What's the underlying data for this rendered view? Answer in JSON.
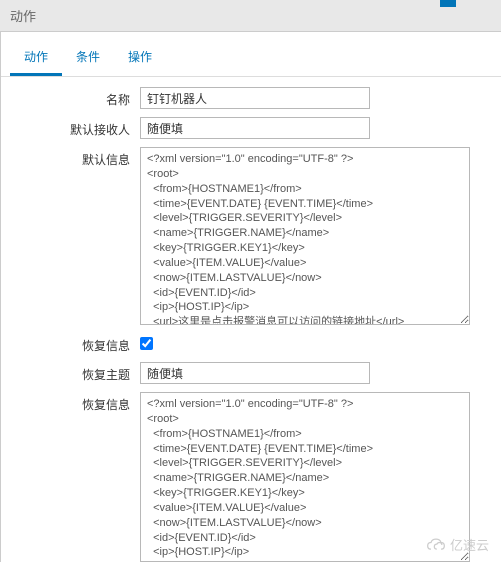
{
  "header": {
    "title": "动作"
  },
  "tabs": [
    {
      "label": "动作",
      "active": true
    },
    {
      "label": "条件",
      "active": false
    },
    {
      "label": "操作",
      "active": false
    }
  ],
  "form": {
    "name_label": "名称",
    "name_value": "钉钉机器人",
    "recipient_label": "默认接收人",
    "recipient_value": "随便填",
    "info_label": "默认信息",
    "info_value": "<?xml version=\"1.0\" encoding=\"UTF-8\" ?>\n<root>\n  <from>{HOSTNAME1}</from>\n  <time>{EVENT.DATE} {EVENT.TIME}</time>\n  <level>{TRIGGER.SEVERITY}</level>\n  <name>{TRIGGER.NAME}</name>\n  <key>{TRIGGER.KEY1}</key>\n  <value>{ITEM.VALUE}</value>\n  <now>{ITEM.LASTVALUE}</now>\n  <id>{EVENT.ID}</id>\n  <ip>{HOST.IP}</ip>\n  <url>这里是点击报警消息可以访问的链接地址</url>\n  <age>{EVENT.AGE}</age>\n  <status>{EVENT.STATUS}</status>\n  <acknowledgement> {EVENT.ACK.STATUS} </acknowledgement>\n  <acknowledgementhistory> {EVENT.ACK.HISTORY} </acknowledgementhistory>\n</root>",
    "recovery_info_label": "恢复信息",
    "recovery_info_checked": true,
    "recovery_subject_label": "恢复主题",
    "recovery_subject_value": "随便填",
    "recovery_msg_label": "恢复信息",
    "recovery_msg_value": "<?xml version=\"1.0\" encoding=\"UTF-8\" ?>\n<root>\n  <from>{HOSTNAME1}</from>\n  <time>{EVENT.DATE} {EVENT.TIME}</time>\n  <level>{TRIGGER.SEVERITY}</level>\n  <name>{TRIGGER.NAME}</name>\n  <key>{TRIGGER.KEY1}</key>\n  <value>{ITEM.VALUE}</value>\n  <now>{ITEM.LASTVALUE}</now>\n  <id>{EVENT.ID}</id>\n  <ip>{HOST.IP}</ip>\n  <color>FF4A934A</color>\n  <url>这里的url会替换报警媒介的url</url>\n  <age>{EVENT.AGE}</age>\n  <recoveryTime>{EVENT.RECOVERY.DATE} {EVENT.RECOVERY.TIME}</recoveryTime>\n  <status>{EVENT.RECOVERY.STATUS}</status>\n</root>"
  },
  "watermark": {
    "text": "亿速云"
  }
}
